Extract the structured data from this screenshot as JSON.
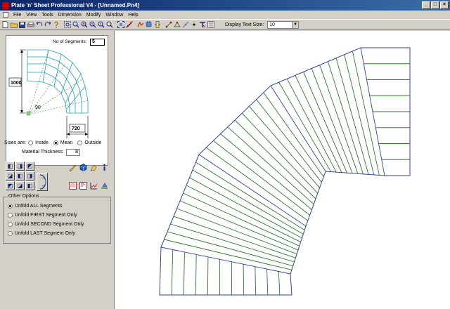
{
  "window": {
    "title": "Plate 'n' Sheet Professional V4 - [Unnamed.Pn4]",
    "minimize": "_",
    "maximize": "□",
    "close": "×"
  },
  "menu": [
    "File",
    "View",
    "Tools",
    "Dimension",
    "Modify",
    "Window",
    "Help"
  ],
  "toolbar": {
    "display_text_size_label": "Display Text Size:",
    "display_text_size_value": "10",
    "dropdown_arrow": "▼",
    "icons": [
      "new-file-icon",
      "open-folder-icon",
      "save-icon",
      "print-icon",
      "undo-icon",
      "redo-icon",
      "help-icon",
      "zoom-window-icon",
      "zoom-all-icon",
      "zoom-in-icon",
      "zoom-out-icon",
      "zoom-previous-icon",
      "zoom-extents-icon",
      "fit-icon",
      "measure-icon",
      "pan-icon",
      "select-icon",
      "rotate-icon",
      "mirror-icon",
      "move-icon",
      "node-icon",
      "trim-icon",
      "text-icon",
      "table-icon"
    ]
  },
  "preview": {
    "segments_label": "No of Segments:",
    "segments_value": "5",
    "height_dim": "1000",
    "angle_dim": "90",
    "width_dim": "720"
  },
  "sizes": {
    "label": "Sizes are:",
    "inside": "Inside",
    "mean": "Mean",
    "outside": "Outside",
    "selected": "mean"
  },
  "material": {
    "label": "Material Thickness",
    "value": "8"
  },
  "options": {
    "title": "Other Options",
    "items": [
      {
        "label": "Unfold ALL Segments",
        "selected": true
      },
      {
        "label": "Unfold FIRST Segment Only",
        "selected": false
      },
      {
        "label": "Unfold SECOND Segment Only",
        "selected": false
      },
      {
        "label": "Unfold LAST Segment Only",
        "selected": false
      }
    ]
  },
  "colors": {
    "outline": "#3040a0",
    "fold_lines": "#2a7a2a",
    "preview_lines": "#20a0c0"
  }
}
